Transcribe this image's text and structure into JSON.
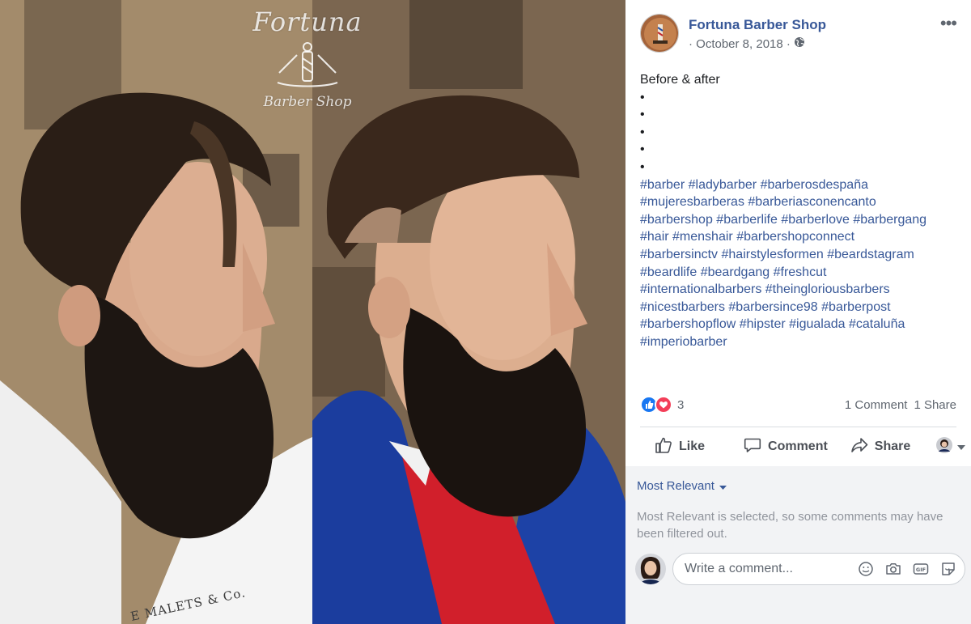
{
  "photo": {
    "watermark_title": "Fortuna",
    "watermark_subtitle": "Barber Shop",
    "apron_text": "E MALETS & Co."
  },
  "post": {
    "page_name": "Fortuna Barber Shop",
    "date": "· October 8, 2018 ·",
    "privacy_icon": "globe-icon",
    "text": "Before & after",
    "bullets": [
      "•",
      "•",
      "•",
      "•",
      "•"
    ],
    "hashtag_lines": [
      [
        "#barber",
        "#ladybarber",
        "#barberosdespaña"
      ],
      [
        "#mujeresbarberas",
        "#barberiasconencanto"
      ],
      [
        "#barbershop",
        "#barberlife",
        "#barberlove",
        "#barbergang"
      ],
      [
        "#hair",
        "#menshair",
        "#barbershopconnect"
      ],
      [
        "#barbersinctv",
        "#hairstylesformen",
        "#beardstagram"
      ],
      [
        "#beardlife",
        "#beardgang",
        "#freshcut"
      ],
      [
        "#internationalbarbers",
        "#theingloriousbarbers"
      ],
      [
        "#nicestbarbers",
        "#barbersince98",
        "#barberpost"
      ],
      [
        "#barbershopflow",
        "#hipster",
        "#igualada",
        "#cataluña"
      ],
      [
        "#imperiobarber"
      ]
    ]
  },
  "reactions": {
    "count": "3",
    "comments": "1 Comment",
    "shares": "1 Share"
  },
  "actions": {
    "like": "Like",
    "comment": "Comment",
    "share": "Share"
  },
  "comments": {
    "sort_label": "Most Relevant",
    "filter_note": "Most Relevant is selected, so some comments may have been filtered out.",
    "placeholder": "Write a comment..."
  },
  "colors": {
    "link": "#385898",
    "like_blue": "#1877f2",
    "love_red": "#f33e58"
  }
}
